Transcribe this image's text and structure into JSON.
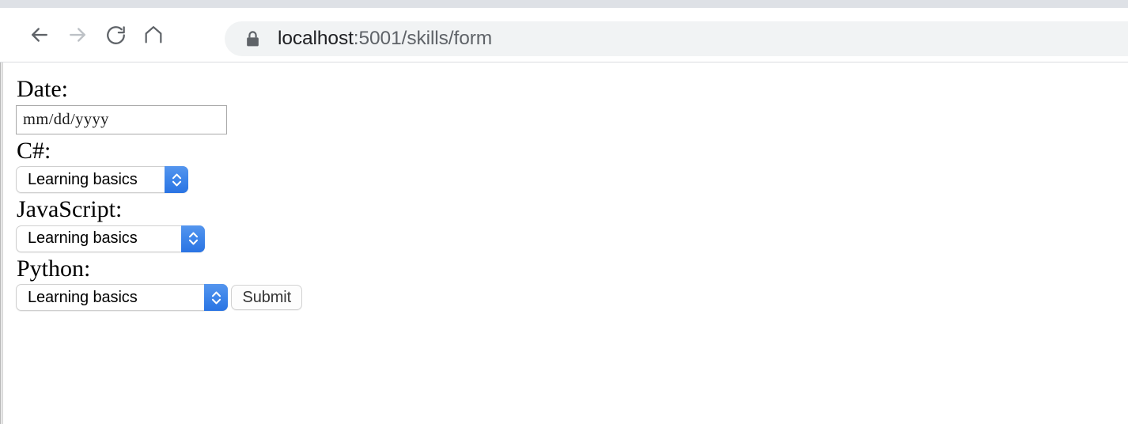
{
  "browser": {
    "nav": {
      "back_label": "Back",
      "back_icon": "arrow-left-icon",
      "forward_label": "Forward",
      "forward_icon": "arrow-right-icon",
      "reload_label": "Reload",
      "reload_icon": "reload-icon",
      "home_label": "Home",
      "home_icon": "home-icon"
    },
    "omnibox": {
      "security_icon": "lock-icon",
      "url_host": "localhost",
      "url_rest": ":5001/skills/form",
      "full_url": "localhost:5001/skills/form"
    }
  },
  "page": {
    "fields": [
      {
        "label": "Date:",
        "type": "date",
        "placeholder": "mm/dd/yyyy",
        "value": ""
      },
      {
        "label": "C#:",
        "type": "select",
        "value": "Learning basics"
      },
      {
        "label": "JavaScript:",
        "type": "select",
        "value": "Learning basics"
      },
      {
        "label": "Python:",
        "type": "select",
        "value": "Learning basics"
      }
    ],
    "submit_label": "Submit"
  },
  "colors": {
    "tabstrip": "#dee1e6",
    "omnibox_bg": "#f1f3f4",
    "url_host": "#202124",
    "url_rest": "#5f6368",
    "stepper_blue": "#3f86ea",
    "page_bg": "#ffffff"
  }
}
